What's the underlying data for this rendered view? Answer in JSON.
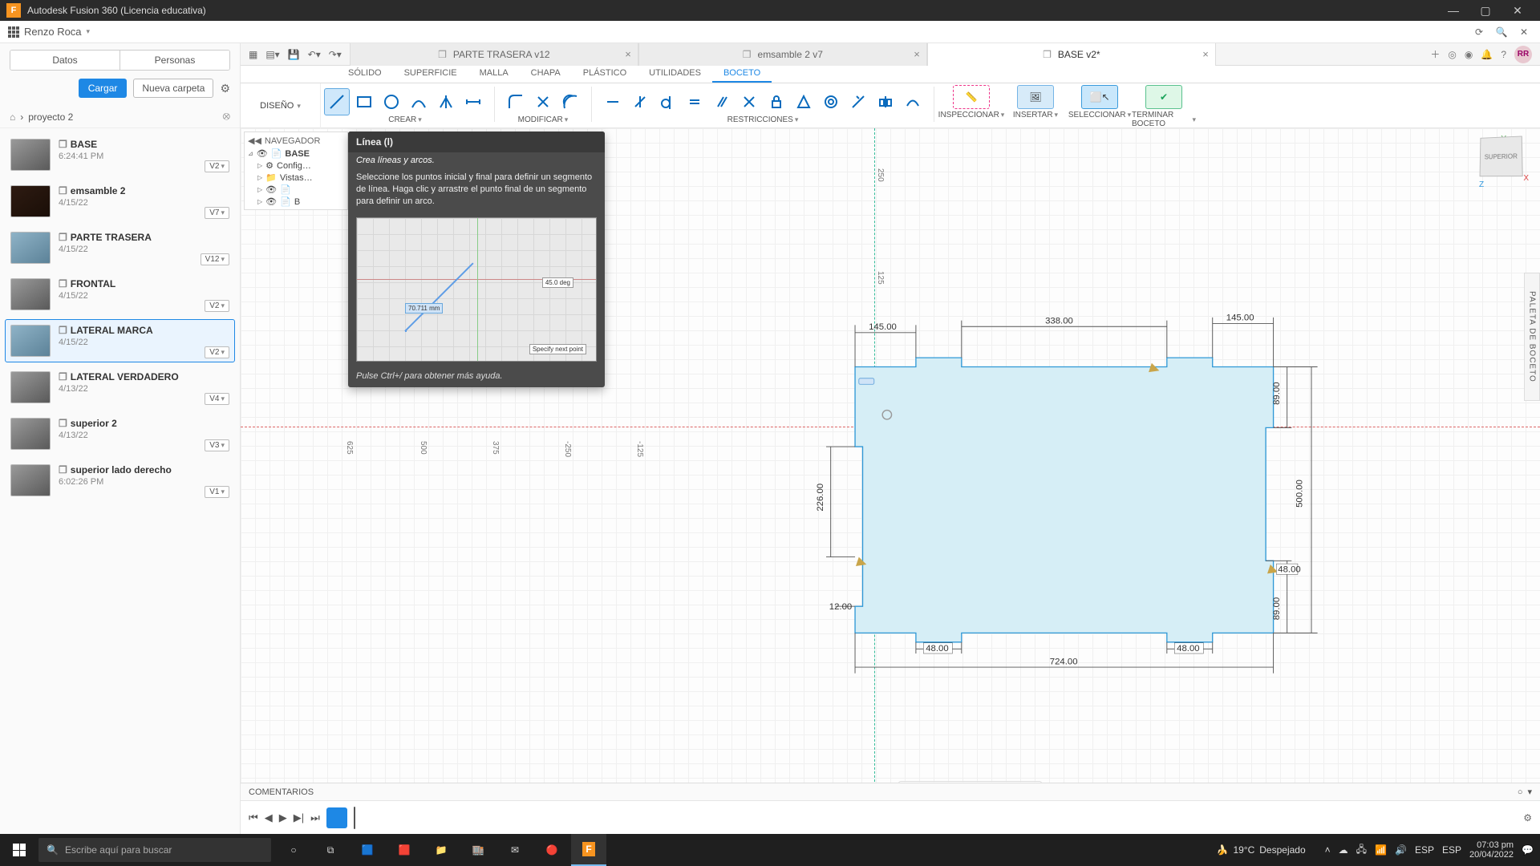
{
  "window": {
    "title": "Autodesk Fusion 360 (Licencia educativa)"
  },
  "user": {
    "name": "Renzo Roca",
    "initials": "RR"
  },
  "data_panel": {
    "tabs": {
      "datos": "Datos",
      "personas": "Personas"
    },
    "upload": "Cargar",
    "new_folder": "Nueva carpeta",
    "breadcrumb": "proyecto 2",
    "items": [
      {
        "name": "BASE",
        "date": "6:24:41 PM",
        "ver": "V2"
      },
      {
        "name": "emsamble 2",
        "date": "4/15/22",
        "ver": "V7"
      },
      {
        "name": "PARTE TRASERA",
        "date": "4/15/22",
        "ver": "V12"
      },
      {
        "name": "FRONTAL",
        "date": "4/15/22",
        "ver": "V2"
      },
      {
        "name": "LATERAL MARCA",
        "date": "4/15/22",
        "ver": "V2"
      },
      {
        "name": "LATERAL VERDADERO",
        "date": "4/13/22",
        "ver": "V4"
      },
      {
        "name": "superior 2",
        "date": "4/13/22",
        "ver": "V3"
      },
      {
        "name": "superior lado derecho",
        "date": "6:02:26 PM",
        "ver": "V1"
      }
    ]
  },
  "doc_tabs": [
    {
      "label": "PARTE TRASERA v12",
      "active": false
    },
    {
      "label": "emsamble 2 v7",
      "active": false
    },
    {
      "label": "BASE v2*",
      "active": true
    }
  ],
  "ribbon": {
    "tabs": [
      "SÓLIDO",
      "SUPERFICIE",
      "MALLA",
      "CHAPA",
      "PLÁSTICO",
      "UTILIDADES",
      "BOCETO"
    ],
    "active": "BOCETO"
  },
  "workspace": "DISEÑO",
  "groups": {
    "crear": "CREAR",
    "modificar": "MODIFICAR",
    "restricciones": "RESTRICCIONES",
    "inspeccionar": "INSPECCIONAR",
    "insertar": "INSERTAR",
    "seleccionar": "SELECCIONAR",
    "terminar": "TERMINAR BOCETO"
  },
  "browser": {
    "title": "NAVEGADOR",
    "root": "BASE",
    "rows": [
      "Config…",
      "Vistas…",
      "",
      ""
    ]
  },
  "tooltip": {
    "title": "Línea (l)",
    "subtitle": "Crea líneas y arcos.",
    "body": "Seleccione los puntos inicial y final para definir un segmento de línea. Haga clic y arrastre el punto final de un segmento para definir un arco.",
    "angle": "45.0 deg",
    "length": "70.711 mm",
    "hint": "Specify next point",
    "footer": "Pulse Ctrl+/ para obtener más ayuda."
  },
  "viewcube": {
    "face": "SUPERIOR",
    "y": "Y",
    "x": "X",
    "z": "Z"
  },
  "palette": "PALETA DE BOCETO",
  "ruler": {
    "n250": "-250",
    "n125": "-125",
    "p250": "250",
    "v625": "625",
    "v500": "500",
    "v375": "375",
    "v250": "-250",
    "h125": "125"
  },
  "dims": {
    "d145a": "145.00",
    "d338": "338.00",
    "d145b": "145.00",
    "d89a": "89.00",
    "d500": "500.00",
    "d48r": "48.00",
    "d89b": "89.00",
    "d226": "226.00",
    "d12": "12.00",
    "d48a": "48.00",
    "d48b": "48.00",
    "d724": "724.00"
  },
  "comments": "COMENTARIOS",
  "taskbar": {
    "search_placeholder": "Escribe aquí para buscar",
    "weather_temp": "19°C",
    "weather_desc": "Despejado",
    "lang1": "ESP",
    "lang2": "ESP",
    "time": "07:03 pm",
    "date": "20/04/2022"
  }
}
